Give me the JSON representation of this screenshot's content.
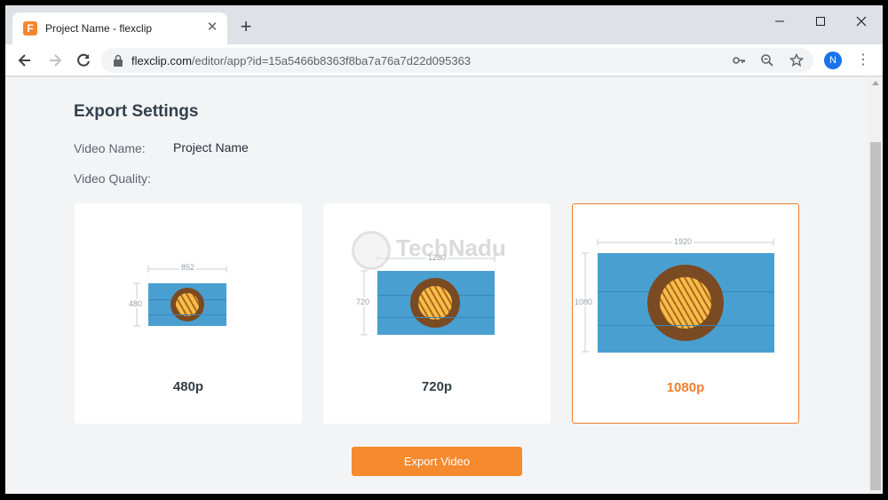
{
  "browser": {
    "tab_title": "Project Name - flexclip",
    "favicon_letter": "F",
    "url_host": "flexclip.com",
    "url_path": "/editor/app?id=15a5466b8363f8ba7a76a7d22d095363",
    "profile_initial": "N"
  },
  "export": {
    "heading": "Export Settings",
    "video_name_label": "Video Name:",
    "video_name_value": "Project Name",
    "video_quality_label": "Video Quality:",
    "button_label": "Export Video",
    "options": [
      {
        "label": "480p",
        "width": "852",
        "height": "480",
        "selected": false
      },
      {
        "label": "720p",
        "width": "1280",
        "height": "720",
        "selected": false
      },
      {
        "label": "1080p",
        "width": "1920",
        "height": "1080",
        "selected": true
      }
    ]
  },
  "watermark": {
    "text": "TechNadu"
  },
  "colors": {
    "accent": "#f58a2f",
    "selected_border": "#f07f2f",
    "chrome_bg": "#dee1e6",
    "page_bg": "#f3f4f6"
  },
  "icons": [
    "back-icon",
    "forward-icon",
    "reload-icon",
    "lock-icon",
    "key-icon",
    "zoom-icon",
    "star-icon",
    "menu-icon",
    "close-icon",
    "plus-icon"
  ]
}
